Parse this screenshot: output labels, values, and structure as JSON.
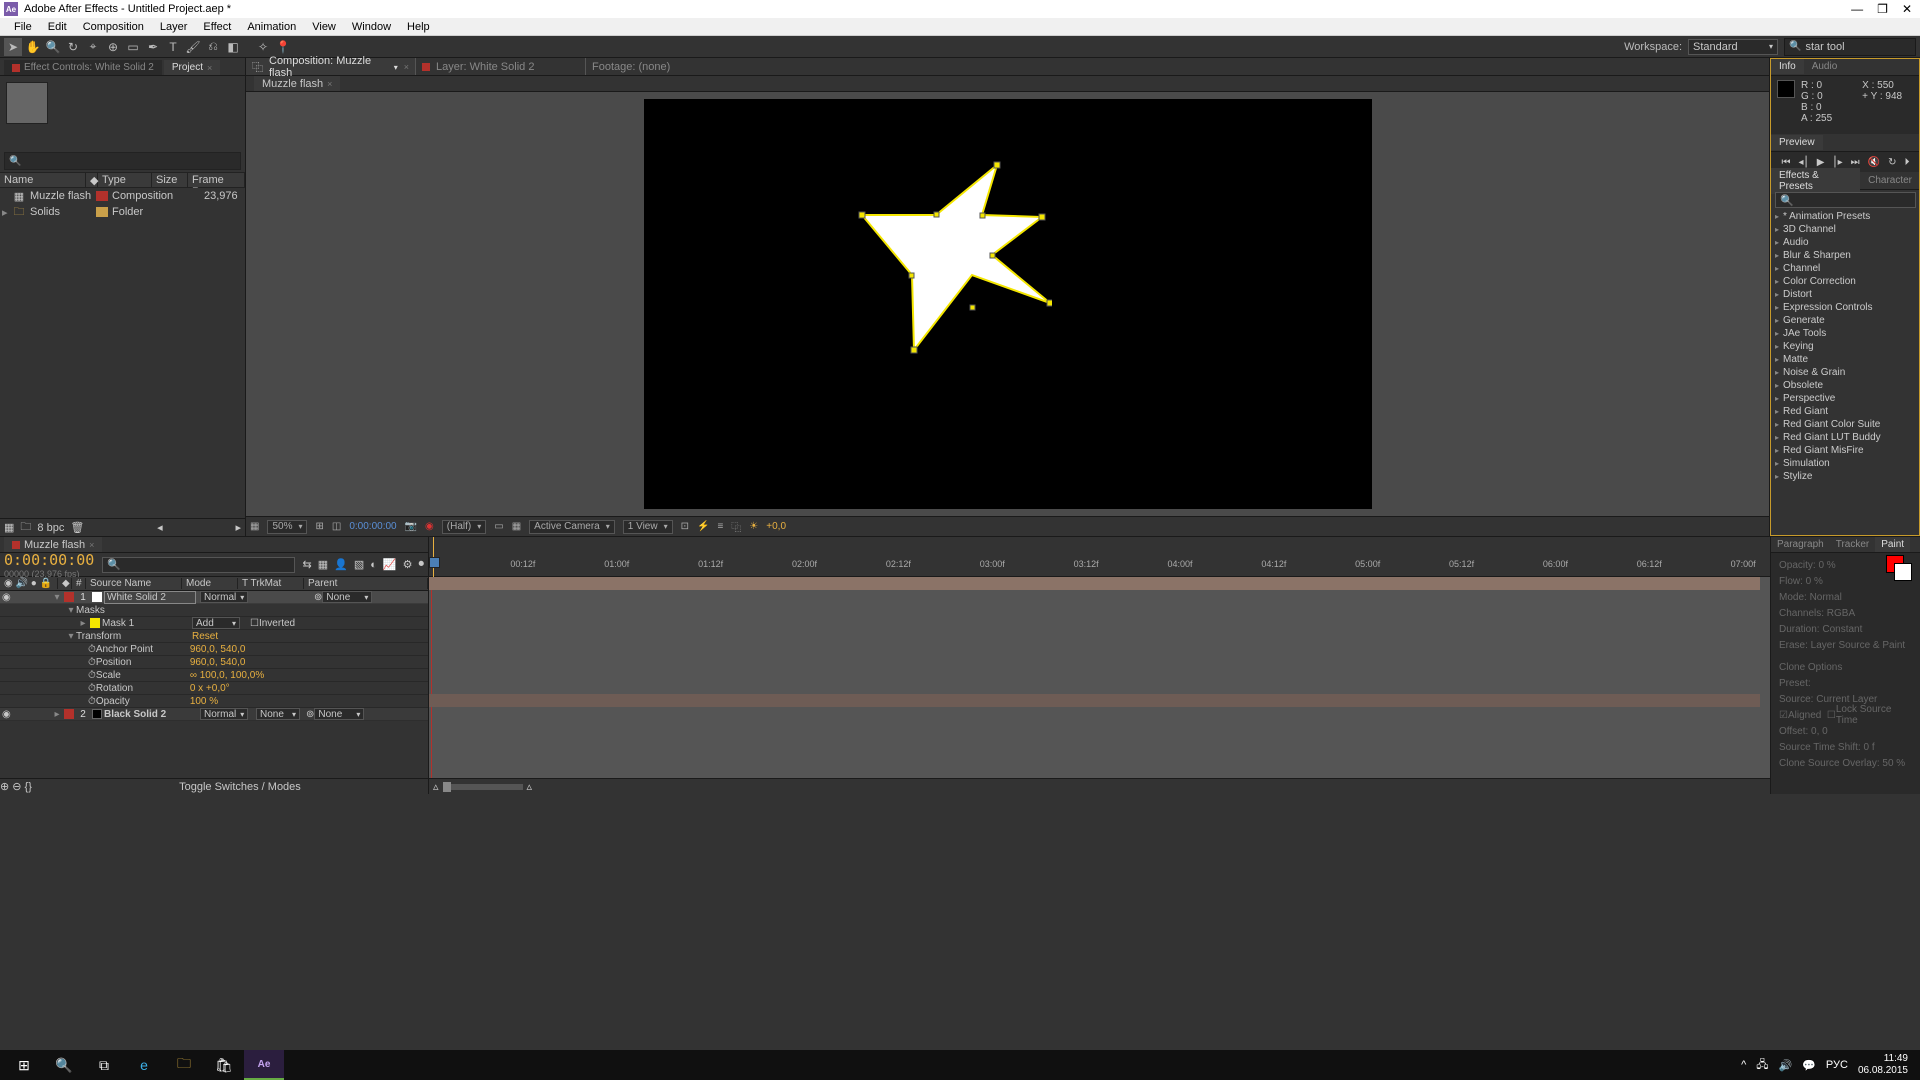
{
  "titlebar": {
    "app": "Adobe After Effects",
    "project": "Untitled Project.aep *",
    "logo": "Ae"
  },
  "menubar": [
    "File",
    "Edit",
    "Composition",
    "Layer",
    "Effect",
    "Animation",
    "View",
    "Window",
    "Help"
  ],
  "toolbar": {
    "workspace_label": "Workspace:",
    "workspace_value": "Standard",
    "search_value": "star tool"
  },
  "project_panel": {
    "tabs": {
      "effect_controls": "Effect Controls: White Solid 2",
      "project": "Project"
    },
    "columns": {
      "name": "Name",
      "type": "Type",
      "size": "Size",
      "frame": "Frame R..."
    },
    "rows": [
      {
        "name": "Muzzle flash",
        "type": "Composition",
        "size": "",
        "fr": "23,976"
      },
      {
        "name": "Solids",
        "type": "Folder",
        "size": "",
        "fr": ""
      }
    ],
    "bpc": "8 bpc"
  },
  "viewer": {
    "tabs": {
      "comp": "Composition: Muzzle flash",
      "layer": "Layer: White Solid 2",
      "footage": "Footage: (none)"
    },
    "subtab": "Muzzle flash",
    "footer": {
      "zoom": "50%",
      "time": "0:00:00:00",
      "res": "(Half)",
      "camera": "Active Camera",
      "views": "1 View",
      "exposure": "+0,0"
    }
  },
  "info": {
    "r": "R : 0",
    "g": "G : 0",
    "b": "B : 0",
    "a": "A : 255",
    "x": "X : 550",
    "y": "Y : 948"
  },
  "panel_labels": {
    "info": "Info",
    "audio": "Audio",
    "preview": "Preview",
    "effects_presets": "Effects & Presets",
    "character": "Character"
  },
  "effects_presets": {
    "items": [
      "* Animation Presets",
      "3D Channel",
      "Audio",
      "Blur & Sharpen",
      "Channel",
      "Color Correction",
      "Distort",
      "Expression Controls",
      "Generate",
      "JAe Tools",
      "Keying",
      "Matte",
      "Noise & Grain",
      "Obsolete",
      "Perspective",
      "Red Giant",
      "Red Giant Color Suite",
      "Red Giant LUT Buddy",
      "Red Giant MisFire",
      "Simulation",
      "Stylize"
    ]
  },
  "timeline": {
    "tab": "Muzzle flash",
    "timecode": "0:00:00:00",
    "sub_timecode": "00000 (23.976 fps)",
    "header": {
      "num": "#",
      "source": "Source Name",
      "mode": "Mode",
      "trkmat": "T  TrkMat",
      "parent": "Parent"
    },
    "layers": [
      {
        "num": "1",
        "name": "White Solid 2",
        "mode": "Normal",
        "trkmat": "",
        "parent": "None",
        "color": "#fff",
        "selected": true
      },
      {
        "num": "2",
        "name": "Black Solid 2",
        "mode": "Normal",
        "trkmat": "None",
        "parent": "None",
        "color": "#000",
        "selected": false
      }
    ],
    "layer1_props": {
      "masks": "Masks",
      "mask1": "Mask 1",
      "mask1_mode": "Add",
      "mask1_inverted": "Inverted",
      "transform": "Transform",
      "reset": "Reset",
      "props": [
        {
          "k": "Anchor Point",
          "v": "960,0, 540,0"
        },
        {
          "k": "Position",
          "v": "960,0, 540,0"
        },
        {
          "k": "Scale",
          "v": "∞ 100,0, 100,0%"
        },
        {
          "k": "Rotation",
          "v": "0 x +0,0°"
        },
        {
          "k": "Opacity",
          "v": "100 %"
        }
      ]
    },
    "ruler": [
      "00:12f",
      "01:00f",
      "01:12f",
      "02:00f",
      "02:12f",
      "03:00f",
      "03:12f",
      "04:00f",
      "04:12f",
      "05:00f",
      "05:12f",
      "06:00f",
      "06:12f",
      "07:00f"
    ],
    "toggle": "Toggle Switches / Modes"
  },
  "paint_panel": {
    "tabs": [
      "Paragraph",
      "Tracker",
      "Paint"
    ],
    "opacity": "Opacity: 0 %",
    "flow": "Flow: 0 %",
    "mode": "Mode:   Normal",
    "channels": "Channels:   RGBA",
    "duration": "Duration:   Constant",
    "erase": "Erase:   Layer Source & Paint",
    "clone_hdr": "Clone Options",
    "preset": "Preset:",
    "source": "Source:   Current Layer",
    "aligned": "Aligned",
    "lock": "Lock Source Time",
    "offset": "Offset: 0,          0",
    "sts": "Source Time Shift: 0  f",
    "overlay": "Clone Source Overlay:  50 %"
  },
  "taskbar": {
    "lang": "РУС",
    "time": "11:49",
    "date": "06.08.2015"
  }
}
